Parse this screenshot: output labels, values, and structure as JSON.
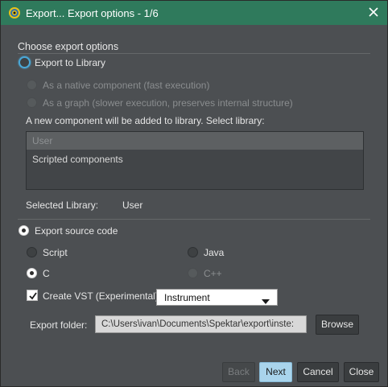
{
  "window": {
    "title": "Export... Export options - 1/6"
  },
  "options": {
    "section_title": "Choose export options",
    "export_to_library": "Export to Library",
    "native_component": "As a native component (fast execution)",
    "as_graph": "As a graph (slower execution, preserves internal structure)",
    "library_prompt": "A new component will be added to library. Select library:",
    "libraries": [
      "User",
      "Scripted components"
    ],
    "selected_library_label": "Selected Library:",
    "selected_library_value": "User",
    "export_source_code": "Export source code",
    "lang_script": "Script",
    "lang_java": "Java",
    "lang_c": "C",
    "lang_cpp": "C++",
    "create_vst": "Create VST (Experimental)",
    "vst_type": "Instrument",
    "export_folder_label": "Export folder:",
    "export_folder_value": "C:\\Users\\ivan\\Documents\\Spektar\\export\\inste:",
    "browse": "Browse"
  },
  "footer": {
    "back": "Back",
    "next": "Next",
    "cancel": "Cancel",
    "close": "Close"
  },
  "icons": {
    "app": "app-logo-icon",
    "close": "close-icon",
    "check": "check-icon",
    "caret": "caret-down-icon"
  },
  "colors": {
    "titlebar": "#2f7a5c",
    "background": "#4c4f52",
    "accent": "#a9d4ec",
    "focus_ring": "#4aa8d8"
  }
}
